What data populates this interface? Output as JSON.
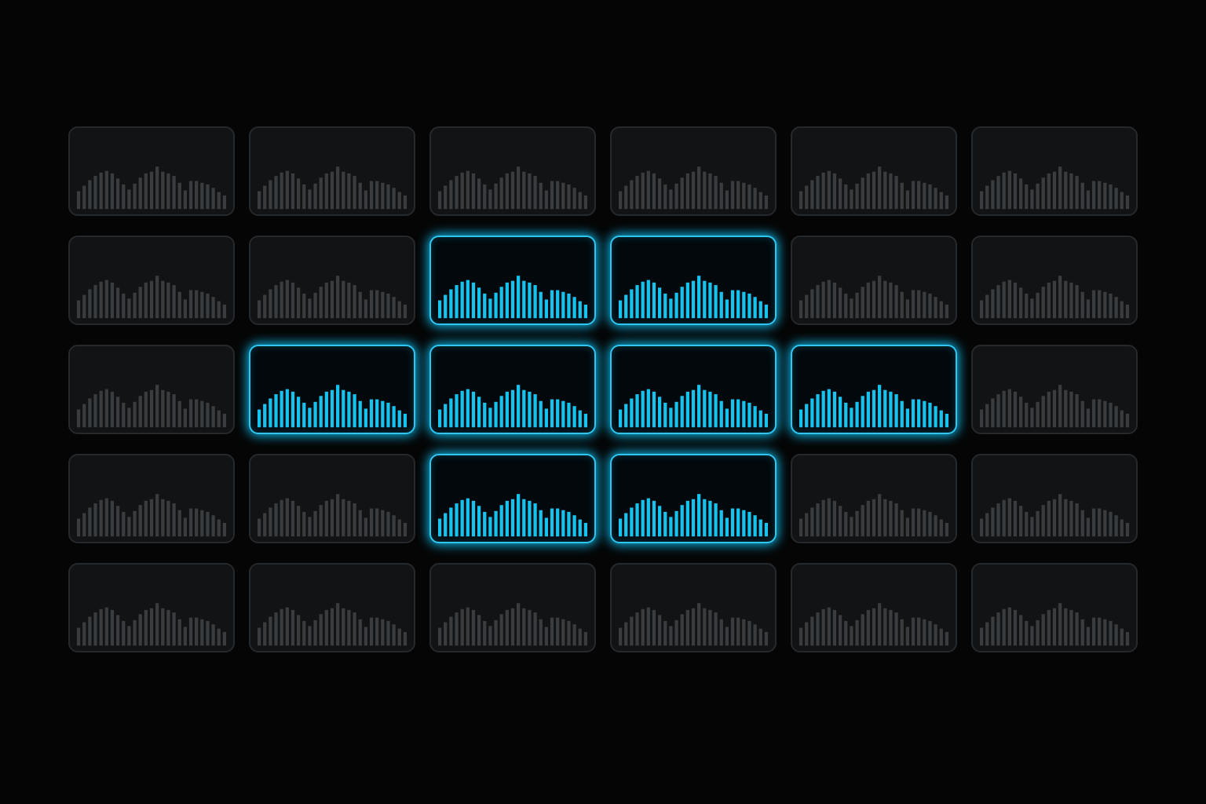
{
  "colors": {
    "background": "#050505",
    "pad_off_fill": "#111315",
    "pad_off_border": "#26292c",
    "pad_off_bars": "#3a3d40",
    "pad_on_fill": "#02080c",
    "pad_on_border": "#2fc6f0",
    "pad_on_bars": "#16c3ee",
    "glow": "#0fb8ea"
  },
  "grid": {
    "rows": 5,
    "columns": 6,
    "active_pads": [
      [
        1,
        2
      ],
      [
        1,
        3
      ],
      [
        2,
        1
      ],
      [
        2,
        2
      ],
      [
        2,
        3
      ],
      [
        2,
        4
      ],
      [
        3,
        2
      ],
      [
        3,
        3
      ]
    ]
  },
  "waveform": {
    "levels": [
      0.42,
      0.55,
      0.68,
      0.78,
      0.86,
      0.9,
      0.84,
      0.72,
      0.58,
      0.46,
      0.6,
      0.74,
      0.84,
      0.88,
      1.0,
      0.88,
      0.84,
      0.78,
      0.62,
      0.44,
      0.66,
      0.66,
      0.62,
      0.58,
      0.5,
      0.4,
      0.32
    ]
  }
}
